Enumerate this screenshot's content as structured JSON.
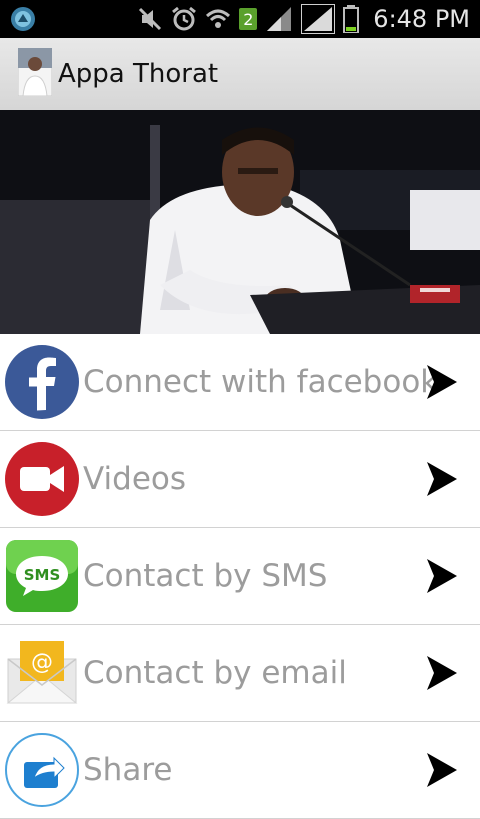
{
  "status_bar": {
    "time": "6:48 PM",
    "sim_badge": "2",
    "icons": [
      "app-notification-icon",
      "mute-icon",
      "alarm-icon",
      "wifi-icon",
      "sim-badge",
      "signal-icon",
      "signal-icon",
      "battery-icon"
    ]
  },
  "action_bar": {
    "title": "Appa Thorat",
    "icon": "profile-photo"
  },
  "hero": {
    "description_icon": "speaker-photo"
  },
  "menu": {
    "items": [
      {
        "label": "Connect with facebook",
        "icon": "facebook-icon",
        "color": "#3b5998"
      },
      {
        "label": "Videos",
        "icon": "video-camera-icon",
        "color": "#c8202a"
      },
      {
        "label": "Contact by SMS",
        "icon": "sms-icon",
        "color": "#3fae2a"
      },
      {
        "label": "Contact by email",
        "icon": "email-icon",
        "color": "#f2b71e"
      },
      {
        "label": "Share",
        "icon": "share-icon",
        "color": "#1e7fcf"
      }
    ]
  }
}
